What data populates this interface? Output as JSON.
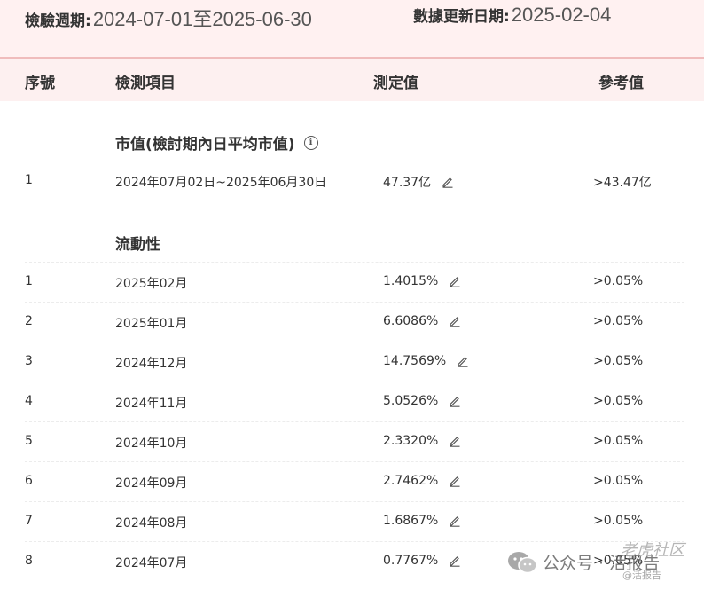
{
  "header": {
    "period_label": "檢驗週期:",
    "period_value": "2024-07-01至2025-06-30",
    "updated_label": "數據更新日期:",
    "updated_value": "2025-02-04"
  },
  "columns": {
    "index": "序號",
    "item": "檢測項目",
    "value": "測定值",
    "reference": "參考值"
  },
  "sections": [
    {
      "title": "市值(檢討期內日平均市值)",
      "rows": [
        {
          "index": "1",
          "item": "2024年07月02日~2025年06月30日",
          "value": "47.37亿",
          "reference": ">43.47亿"
        }
      ]
    },
    {
      "title": "流動性",
      "rows": [
        {
          "index": "1",
          "item": "2025年02月",
          "value": "1.4015%",
          "reference": ">0.05%"
        },
        {
          "index": "2",
          "item": "2025年01月",
          "value": "6.6086%",
          "reference": ">0.05%"
        },
        {
          "index": "3",
          "item": "2024年12月",
          "value": "14.7569%",
          "reference": ">0.05%"
        },
        {
          "index": "4",
          "item": "2024年11月",
          "value": "5.0526%",
          "reference": ">0.05%"
        },
        {
          "index": "5",
          "item": "2024年10月",
          "value": "2.3320%",
          "reference": ">0.05%"
        },
        {
          "index": "6",
          "item": "2024年09月",
          "value": "2.7462%",
          "reference": ">0.05%"
        },
        {
          "index": "7",
          "item": "2024年08月",
          "value": "1.6867%",
          "reference": ">0.05%"
        },
        {
          "index": "8",
          "item": "2024年07月",
          "value": "0.7767%",
          "reference": ">0.05%"
        }
      ]
    }
  ],
  "watermark": {
    "line1": "公众号 · 活报告",
    "line2": "老虎社区",
    "line3": "@活报告"
  },
  "icons": {
    "info": "info-icon",
    "edit": "pencil-icon",
    "logo": "wechat-icon"
  },
  "colors": {
    "header_bg": "#fff1f1",
    "header_border": "#f0bcbc",
    "text": "#333333"
  }
}
